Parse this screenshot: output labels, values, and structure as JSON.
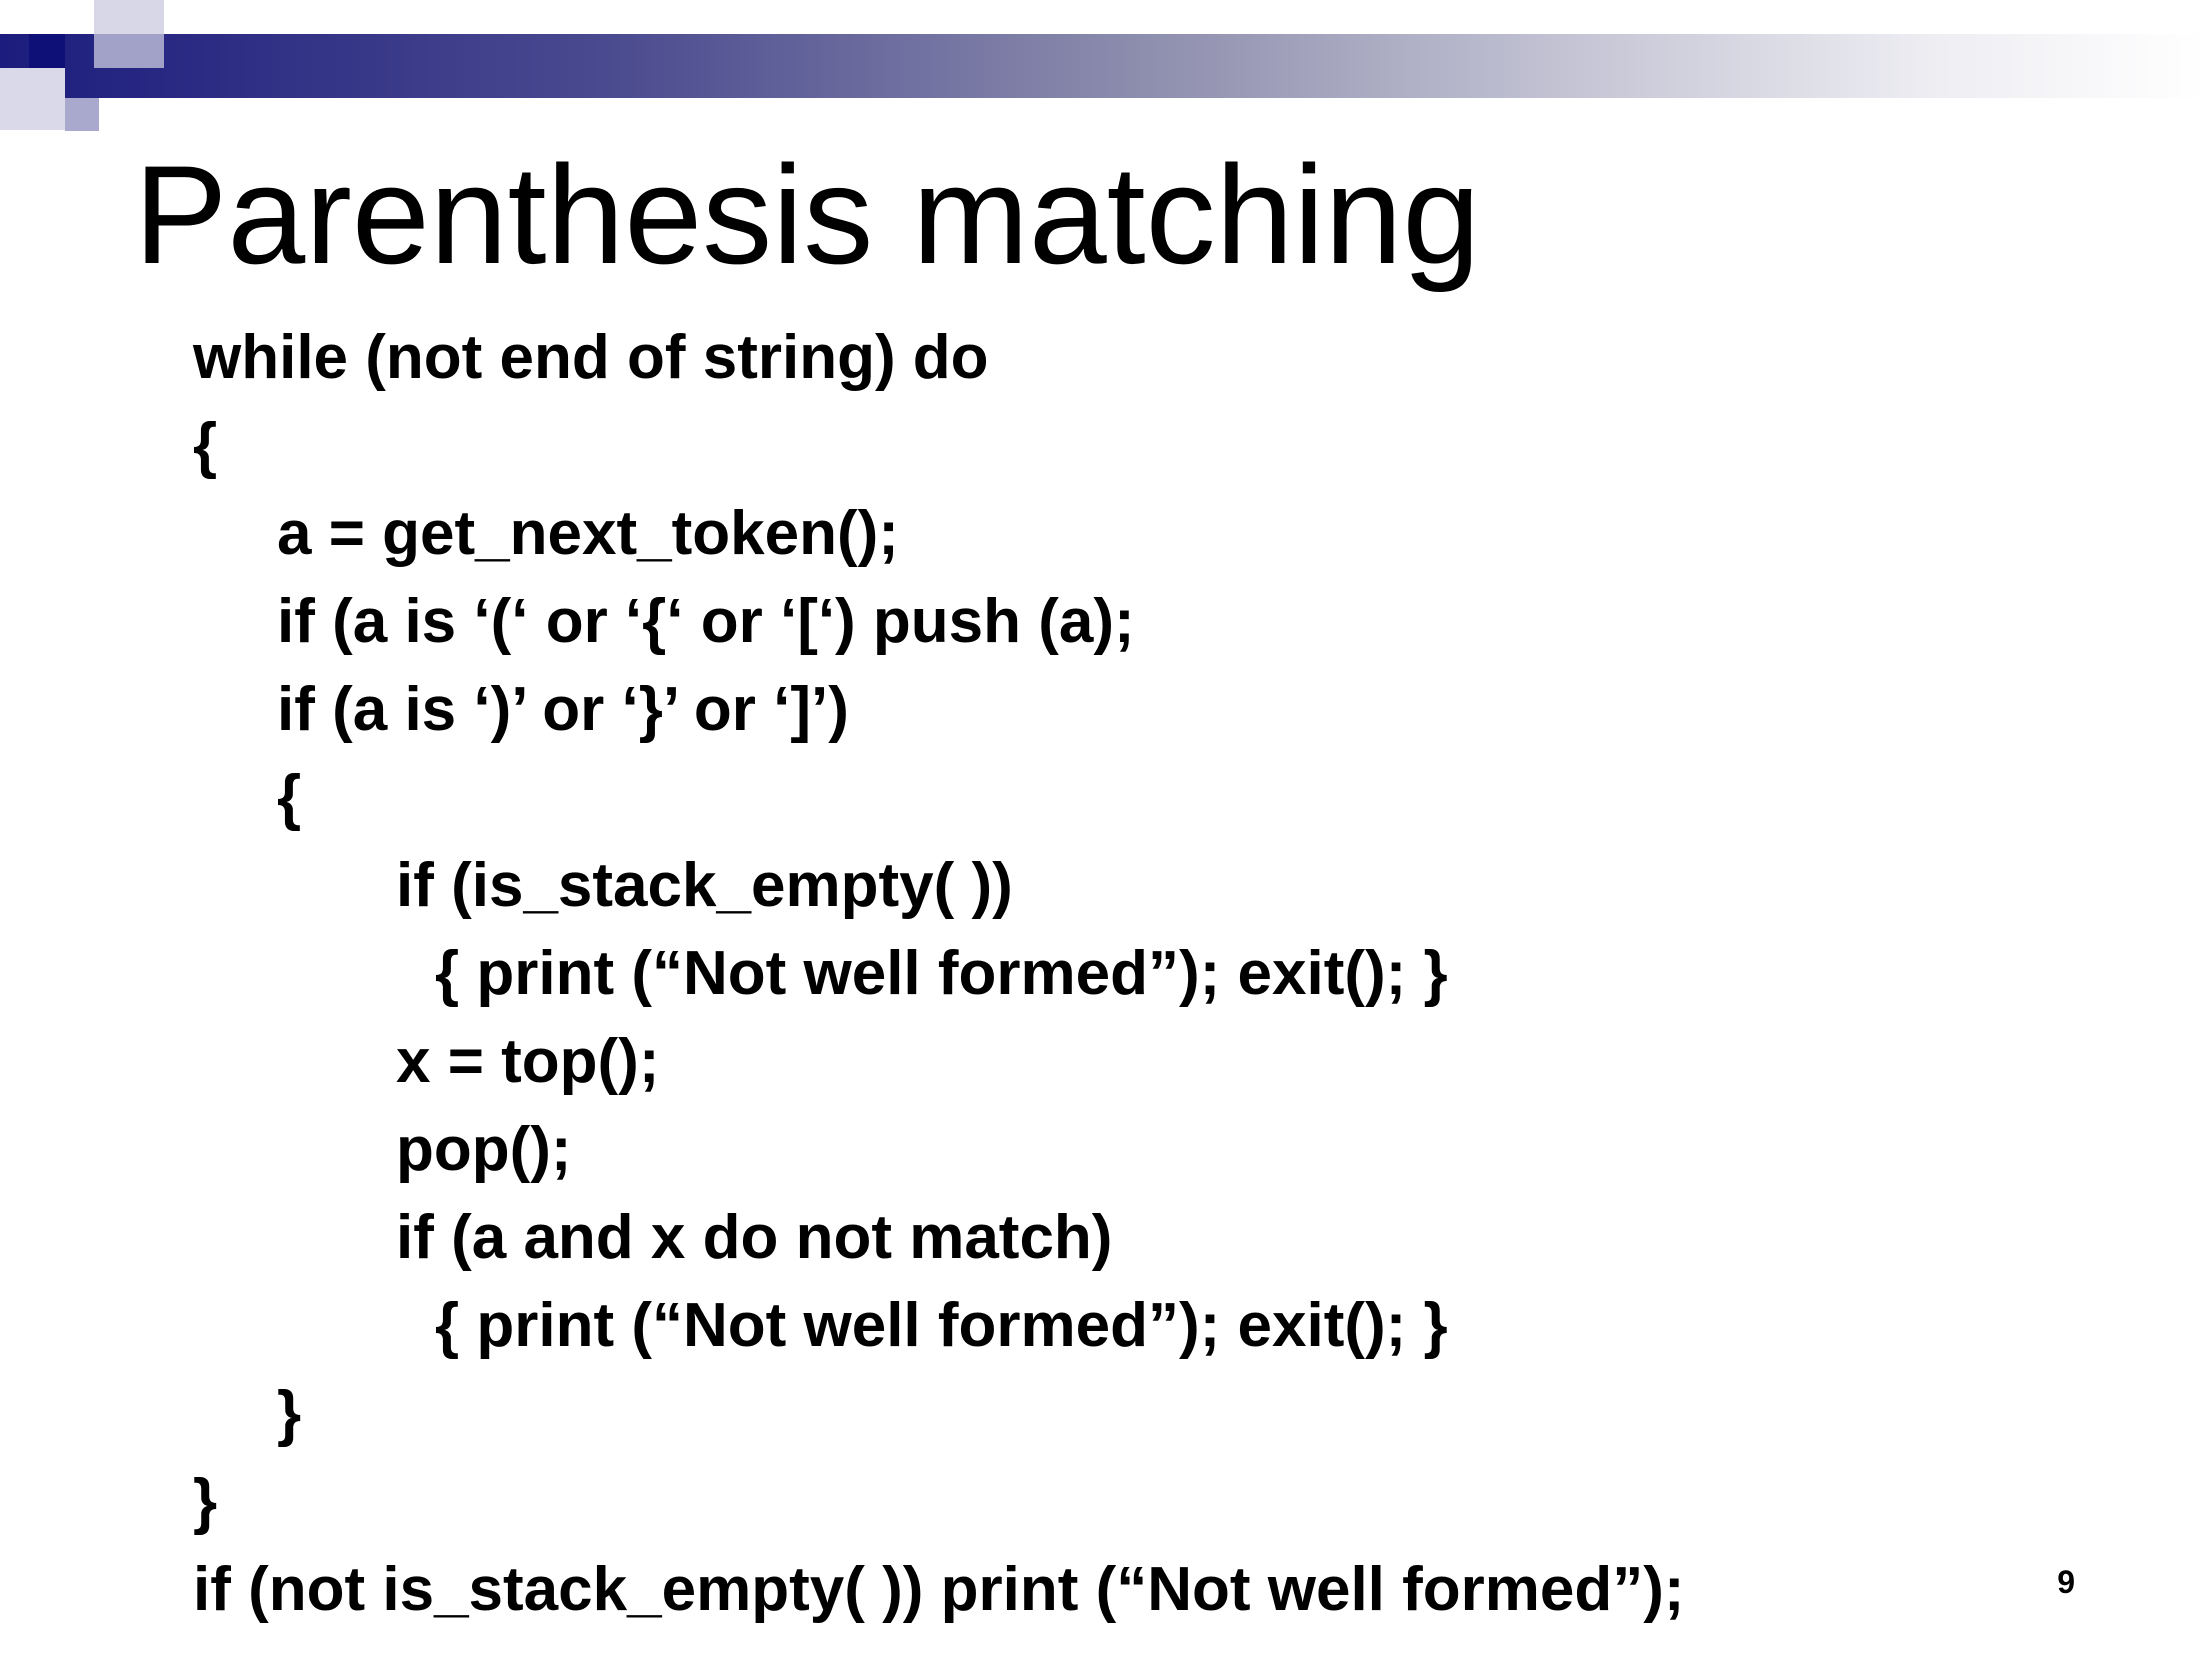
{
  "slide": {
    "title": "Parenthesis matching",
    "page_number": "9",
    "code_lines": [
      "while (not end of string) do",
      "{",
      "a = get_next_token();",
      "if (a is ‘(‘ or ‘{‘ or ‘[‘) push (a);",
      "if (a is ‘)’ or ‘}’ or ‘]’)",
      "{",
      "if (is_stack_empty( ))",
      "{ print (“Not well formed”); exit(); }",
      "x = top();",
      "pop();",
      "if (a and x do not match)",
      "{ print (“Not well formed”); exit(); }",
      "}",
      "}",
      "if (not is_stack_empty( )) print (“Not well formed”);"
    ]
  },
  "theme": {
    "header_gradient_start": "#1c1c7e",
    "header_gradient_end": "#ffffff",
    "text_color": "#000000"
  }
}
